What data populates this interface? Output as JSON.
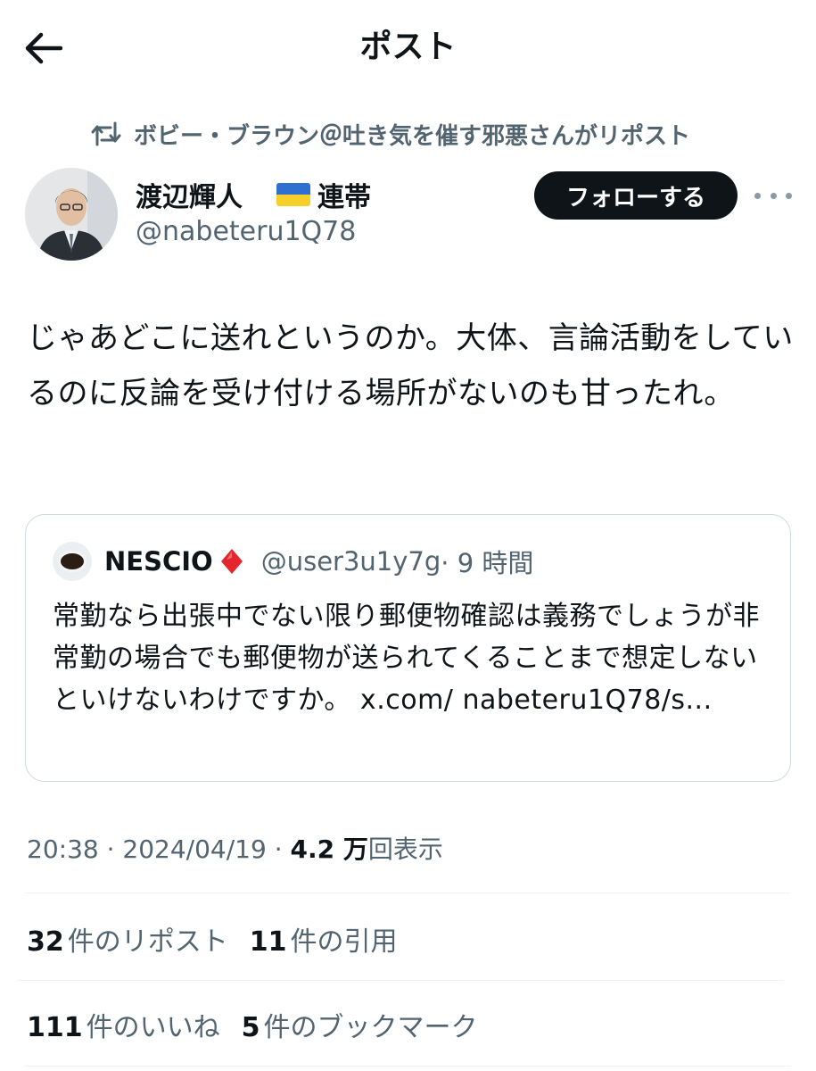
{
  "header": {
    "title": "ポスト"
  },
  "repost_context": {
    "text": "ボビー・ブラウン＠吐き気を催す邪悪さんがリポスト"
  },
  "author": {
    "name": "渡辺輝人",
    "name_suffix": "連帯",
    "handle": "@nabeteru1Q78",
    "follow_label": "フォローする"
  },
  "post": {
    "text": "じゃあどこに送れというのか。大体、言論活動をしているのに反論を受け付ける場所がないのも甘ったれ。"
  },
  "quote": {
    "name": "NESCIO",
    "handle": "@user3u1y7g",
    "time": "· 9 時間",
    "text": "常勤なら出張中でない限り郵便物確認は義務でしょうが非常勤の場合でも郵便物が送られてくることまで想定しないといけないわけですか。 x.com/ nabeteru1Q78/s..."
  },
  "meta": {
    "time": "20:38",
    "sep1": "·",
    "date": "2024/04/19",
    "sep2": "·",
    "views_count": "4.2 万",
    "views_label": "回表示"
  },
  "stats": {
    "reposts_count": "32",
    "reposts_label": "件のリポスト",
    "quotes_count": "11",
    "quotes_label": "件の引用",
    "likes_count": "111",
    "likes_label": "件のいいね",
    "bookmarks_count": "5",
    "bookmarks_label": "件のブックマーク"
  },
  "colors": {
    "text_primary": "#0f1419",
    "text_secondary": "#536471",
    "border": "#cfd9de",
    "follow_bg": "#0f1419",
    "diamond": "#e3262e"
  },
  "icons": {
    "back": "arrow-left-icon",
    "repost": "repost-icon",
    "more": "more-horizontal-icon",
    "badge": "red-diamond-icon"
  }
}
